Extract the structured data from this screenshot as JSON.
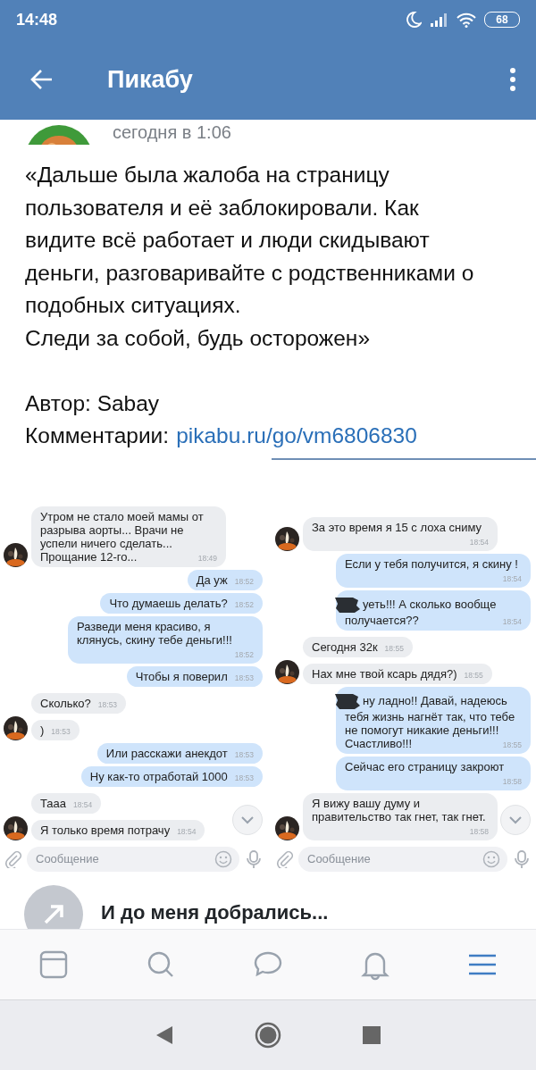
{
  "status_bar": {
    "time": "14:48",
    "battery": "68"
  },
  "header": {
    "title": "Пикабу"
  },
  "post": {
    "date": "сегодня в 1:06",
    "paragraphs": [
      "«Дальше была жалоба на страницу пользователя и её заблокировали. Как видите всё работает и люди скидывают деньги, разговаривайте с родственниками о подобных ситуациях.",
      "Следи за собой, будь осторожен»"
    ],
    "author": "Автор: Sabay",
    "comments_label": "Комментарии:",
    "comments_link": "pikabu.ru/go/vm6806830"
  },
  "chats": [
    {
      "messages": [
        {
          "kind": "incoming",
          "text": "Утром не стало моей мамы от разрыва аорты... Врачи не успели ничего сделать... Прощание 12-го...",
          "time": "18:49",
          "avatar": true
        },
        {
          "kind": "outgoing",
          "text": "Да уж",
          "time": "18:52"
        },
        {
          "kind": "outgoing",
          "text": "Что думаешь делать?",
          "time": "18:52"
        },
        {
          "kind": "outgoing",
          "text": "Разведи меня красиво, я клянусь, скину тебе деньги!!!",
          "time": "18:52"
        },
        {
          "kind": "outgoing",
          "text": "Чтобы я поверил",
          "time": "18:53"
        },
        {
          "kind": "incoming",
          "text": "Сколько?",
          "time": "18:53",
          "avatar": false
        },
        {
          "kind": "incoming",
          "text": ")",
          "time": "18:53",
          "avatar": true
        },
        {
          "kind": "outgoing",
          "text": "Или расскажи анекдот",
          "time": "18:53"
        },
        {
          "kind": "outgoing",
          "text": "Ну как-то отработай 1000",
          "time": "18:53"
        },
        {
          "kind": "incoming",
          "text": "Тааа",
          "time": "18:54",
          "avatar": false
        },
        {
          "kind": "incoming",
          "text": "Я только время потрачу",
          "time": "18:54",
          "avatar": true
        }
      ],
      "compose_placeholder": "Сообщение"
    },
    {
      "messages": [
        {
          "kind": "incoming",
          "text": "За это время я 15 с лоха сниму",
          "time": "18:54",
          "avatar": true
        },
        {
          "kind": "outgoing",
          "text": "Если у тебя получится, я скину !",
          "time": "18:54"
        },
        {
          "kind": "outgoing",
          "text": "уеть!!! А сколько вообще получается??",
          "time": "18:54",
          "redacted": true
        },
        {
          "kind": "incoming",
          "text": "Сегодня 32к",
          "time": "18:55",
          "avatar": false
        },
        {
          "kind": "incoming",
          "text": "Нах мне твой ксарь дядя?)",
          "time": "18:55",
          "avatar": true
        },
        {
          "kind": "outgoing",
          "text": "ну ладно!! Давай, надеюсь тебя жизнь нагнёт так, что тебе не помогут никакие деньги!!! Счастливо!!!",
          "time": "18:55",
          "redacted": true
        },
        {
          "kind": "outgoing",
          "text": "Сейчас его страницу закроют",
          "time": "18:58"
        },
        {
          "kind": "incoming",
          "text": "Я вижу вашу думу и правительство так гнет, так гнет.",
          "time": "18:58",
          "avatar": true
        }
      ],
      "compose_placeholder": "Сообщение"
    }
  ],
  "next_post": {
    "title": "И до меня добрались..."
  },
  "tab_bar": [
    {
      "kind": "feed",
      "selected": false
    },
    {
      "kind": "search",
      "selected": false
    },
    {
      "kind": "messages",
      "selected": false
    },
    {
      "kind": "notifications",
      "selected": false
    },
    {
      "kind": "menu",
      "selected": true
    }
  ]
}
